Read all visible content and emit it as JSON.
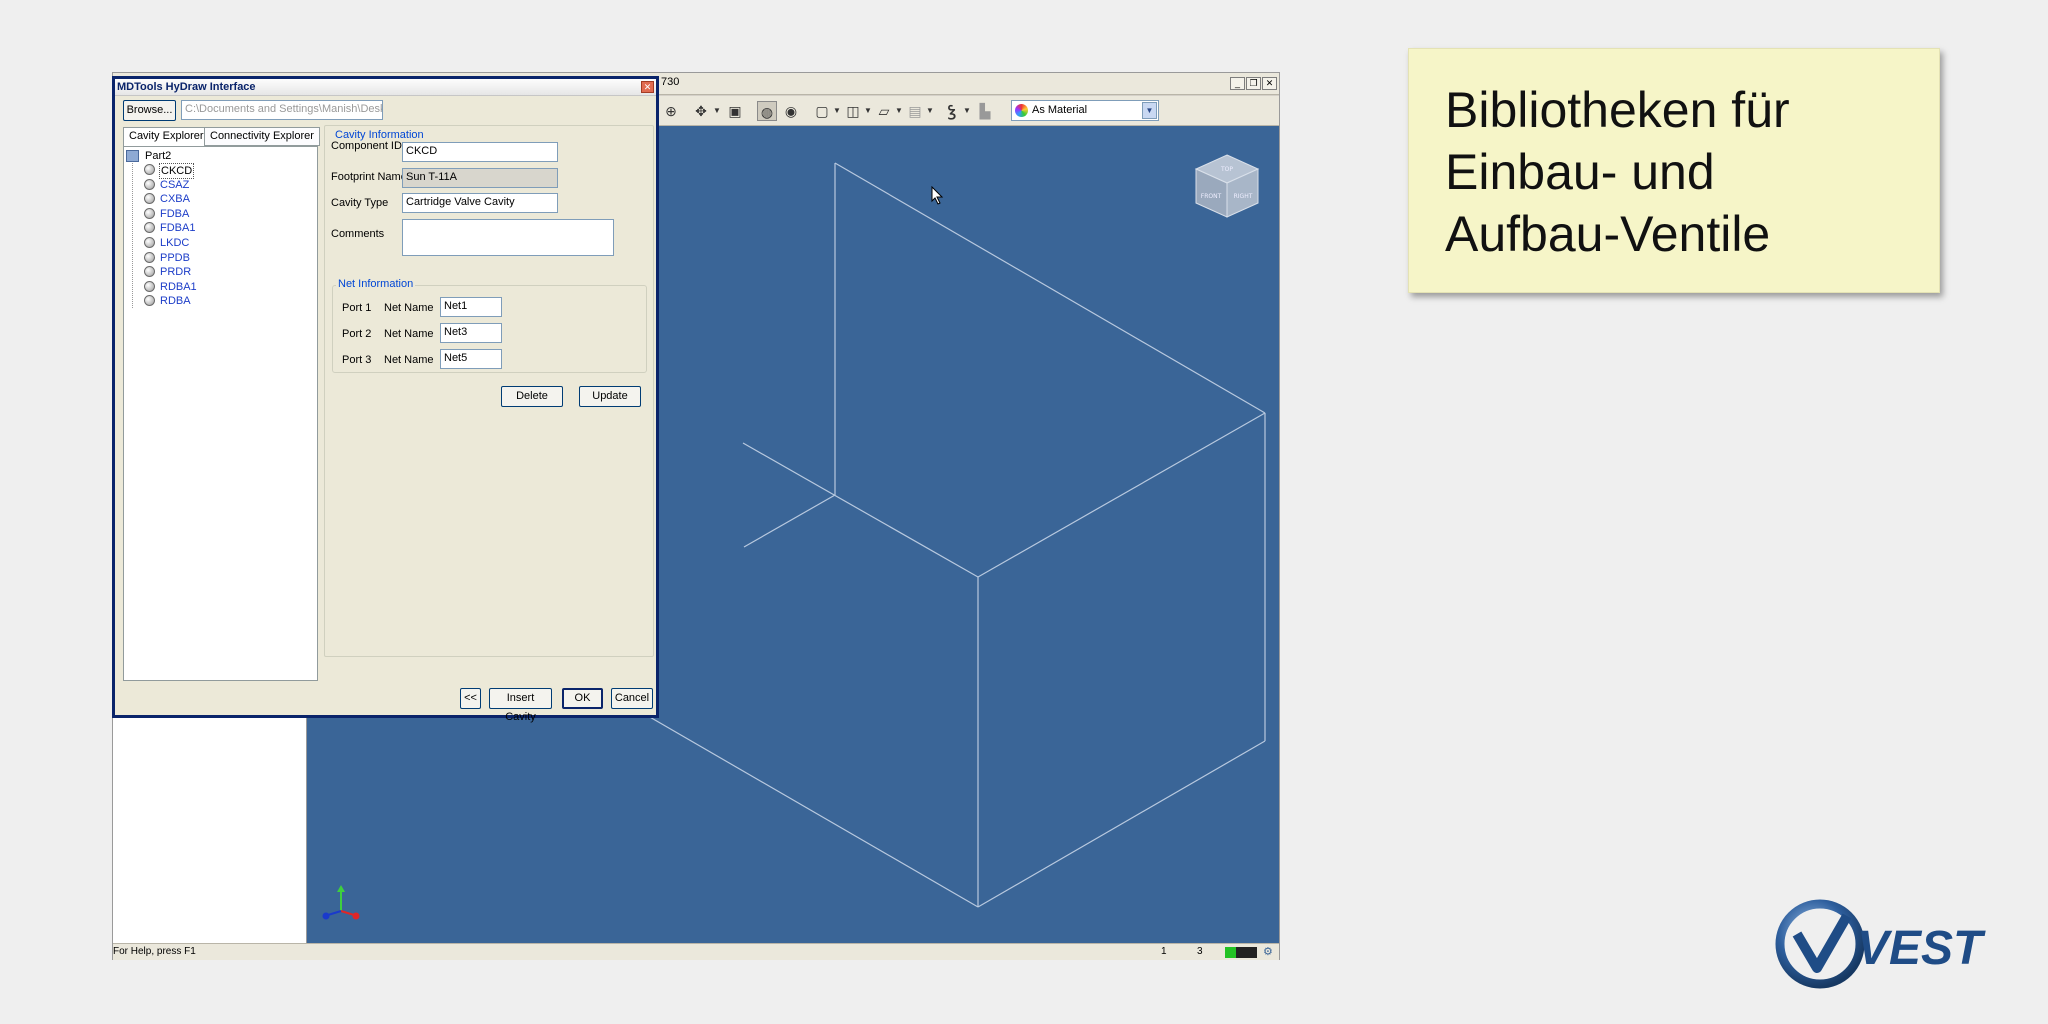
{
  "cad_app": {
    "title_fragment": "730",
    "window_controls": [
      "_",
      "❐",
      "✕"
    ],
    "material_select": {
      "value": "As Material"
    },
    "status": {
      "help_text": "For Help, press F1",
      "num1": "1",
      "num2": "3",
      "meter_level": 0.35
    },
    "viewcube_labels": [
      "TOP",
      "FRONT",
      "RIGHT"
    ]
  },
  "dialog": {
    "title": "MDTools HyDraw Interface",
    "close_glyph": "✕",
    "browse_label": "Browse...",
    "path_value": "C:\\Documents and Settings\\Manish\\Desktop",
    "tabs": [
      {
        "label": "Cavity Explorer"
      },
      {
        "label": "Connectivity Explorer"
      }
    ],
    "tree": {
      "root": "Part2",
      "items": [
        {
          "label": "CKCD",
          "selected": true
        },
        {
          "label": "CSAZ"
        },
        {
          "label": "CXBA"
        },
        {
          "label": "FDBA"
        },
        {
          "label": "FDBA1"
        },
        {
          "label": "LKDC"
        },
        {
          "label": "PPDB"
        },
        {
          "label": "PRDR"
        },
        {
          "label": "RDBA1"
        },
        {
          "label": "RDBA"
        }
      ]
    },
    "cavity_info": {
      "legend": "Cavity Information",
      "component_id_label": "Component ID",
      "component_id_value": "CKCD",
      "footprint_label": "Footprint Name",
      "footprint_value": "Sun T-11A",
      "cavity_type_label": "Cavity Type",
      "cavity_type_value": "Cartridge Valve Cavity",
      "comments_label": "Comments",
      "comments_value": ""
    },
    "net_info": {
      "legend": "Net Information",
      "ports": [
        {
          "port": "Port 1",
          "net_label": "Net  Name",
          "value": "Net1"
        },
        {
          "port": "Port 2",
          "net_label": "Net  Name",
          "value": "Net3"
        },
        {
          "port": "Port 3",
          "net_label": "Net  Name",
          "value": "Net5"
        }
      ]
    },
    "buttons": {
      "delete": "Delete",
      "update": "Update",
      "back": "<<",
      "insert_cavity": "Insert Cavity",
      "ok": "OK",
      "cancel": "Cancel"
    }
  },
  "callout": {
    "lines": [
      "Bibliotheken für",
      "Einbau- und",
      "Aufbau-Ventile"
    ]
  },
  "logo": {
    "text": "VEST"
  },
  "colors": {
    "viewport": "#3a6597",
    "dialog_border": "#0a246a",
    "callout_bg": "#f6f5c8",
    "tree_link": "#1c3dc8"
  }
}
